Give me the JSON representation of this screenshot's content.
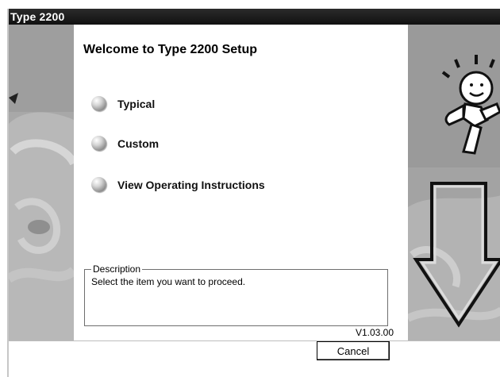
{
  "window": {
    "title": "Type 2200"
  },
  "main": {
    "heading": "Welcome to Type 2200 Setup",
    "options": [
      {
        "label": "Typical",
        "icon": "radio-ball-icon"
      },
      {
        "label": "Custom",
        "icon": "radio-ball-icon"
      },
      {
        "label": "View Operating Instructions",
        "icon": "radio-ball-icon"
      }
    ],
    "description": {
      "legend": "Description",
      "text": "Select the item you want to proceed."
    },
    "version": "V1.03.00"
  },
  "footer": {
    "cancel_label": "Cancel"
  },
  "colors": {
    "titlebar": "#1c1c1c",
    "art_gray": "#9c9c9c",
    "panel": "#ffffff"
  }
}
